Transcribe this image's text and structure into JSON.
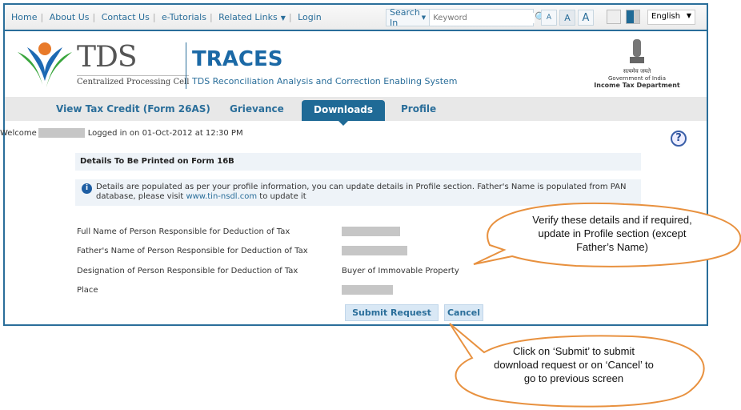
{
  "top_nav": {
    "links": [
      "Home",
      "About Us",
      "Contact Us",
      "e-Tutorials",
      "Related Links",
      "Login"
    ],
    "search_label": "Search In",
    "search_placeholder": "Keyword",
    "font_sizes": [
      "A",
      "A",
      "A"
    ],
    "language": "English"
  },
  "header": {
    "tds": "TDS",
    "cpc": "Centralized Processing Cell",
    "traces": "TRACES",
    "traces_sub": "TDS Reconciliation Analysis and Correction Enabling System",
    "gov_line1": "सत्यमेव जयते",
    "gov_line2": "Government of India",
    "gov_line3": "Income Tax Department"
  },
  "tabs": [
    {
      "label": "View Tax Credit (Form 26AS)",
      "active": false
    },
    {
      "label": "Grievance",
      "active": false
    },
    {
      "label": "Downloads",
      "active": true
    },
    {
      "label": "Profile",
      "active": false
    }
  ],
  "welcome": {
    "prefix": "Welcome",
    "logged": "Logged in on 01-Oct-2012 at 12:30 PM"
  },
  "section": {
    "title": "Details To Be Printed on Form 16B",
    "info_text": "Details are populated as per your profile information, you can update details in Profile section. Father's Name is populated from PAN database, please visit ",
    "info_link": "www.tin-nsdl.com",
    "info_suffix": " to update it"
  },
  "fields": [
    {
      "label": "Full Name of Person Responsible for Deduction of Tax",
      "value": ""
    },
    {
      "label": "Father's Name of Person Responsible for Deduction of Tax",
      "value": ""
    },
    {
      "label": "Designation of Person Responsible for Deduction of Tax",
      "value": "Buyer of Immovable Property"
    },
    {
      "label": "Place",
      "value": ""
    }
  ],
  "buttons": {
    "submit": "Submit Request",
    "cancel": "Cancel"
  },
  "callouts": {
    "one": "Verify these details and if required, update in Profile section (except Father’s Name)",
    "two": "Click on ‘Submit’ to submit download request or on ‘Cancel’ to go to previous screen"
  },
  "colors": {
    "brand": "#1f6a96",
    "callout_border": "#e8913f"
  }
}
